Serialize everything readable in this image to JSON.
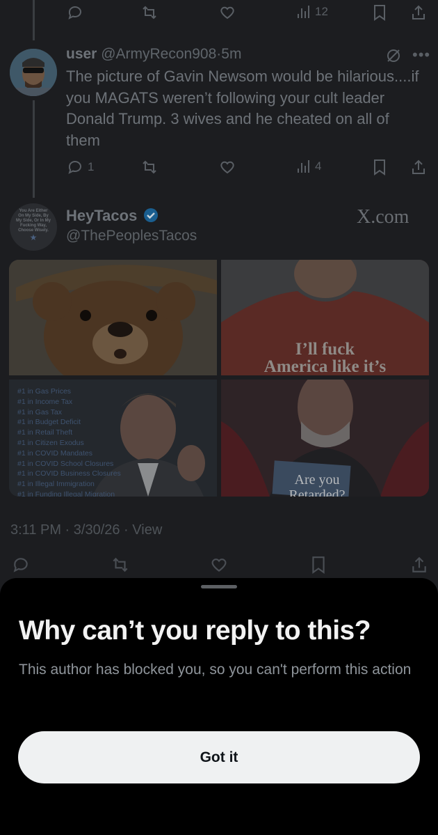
{
  "top_actions": {
    "views": "12"
  },
  "reply": {
    "display_name": "user",
    "handle": "@ArmyRecon908",
    "sep": "·",
    "time": "5m",
    "text": "The picture of Gavin Newsom would be hilarious....if you MAGATS weren’t following your cult leader Donald Trump. 3 wives and he cheated on all of them",
    "replies": "1",
    "views": "4"
  },
  "main": {
    "avatar_text": "You Are Either On My Side, By My Side, Or In My Fucking Way, Choose Wisely.",
    "display_name": "HeyTacos",
    "handle": "@ThePeoplesTacos",
    "source": "X.com",
    "timestamp": "3:11 PM · 3/30/26 · View",
    "media": {
      "shirt_line1": "I’ll fuck",
      "shirt_line2": "America like it’s",
      "rankings": [
        "#1 in Gas Prices",
        "#1 in Income Tax",
        "#1 in Gas Tax",
        "#1 in Budget Deficit",
        "#1 in Retail Theft",
        "#1 in Citizen Exodus",
        "#1 in COVID Mandates",
        "#1 in COVID School Closures",
        "#1 in COVID Business Closures",
        "#1 in Illegal Immigration",
        "#1 in Funding Illegal Migration"
      ],
      "book_line1": "Are you",
      "book_line2": "Retarded?"
    }
  },
  "sheet": {
    "title": "Why can’t you reply to this?",
    "body": "This author has blocked you, so you can't perform this action",
    "button": "Got it"
  },
  "colors": {
    "accent_verified": "#1d9bf0",
    "sheet_bg": "#000000",
    "button_bg": "#eff1f2"
  }
}
